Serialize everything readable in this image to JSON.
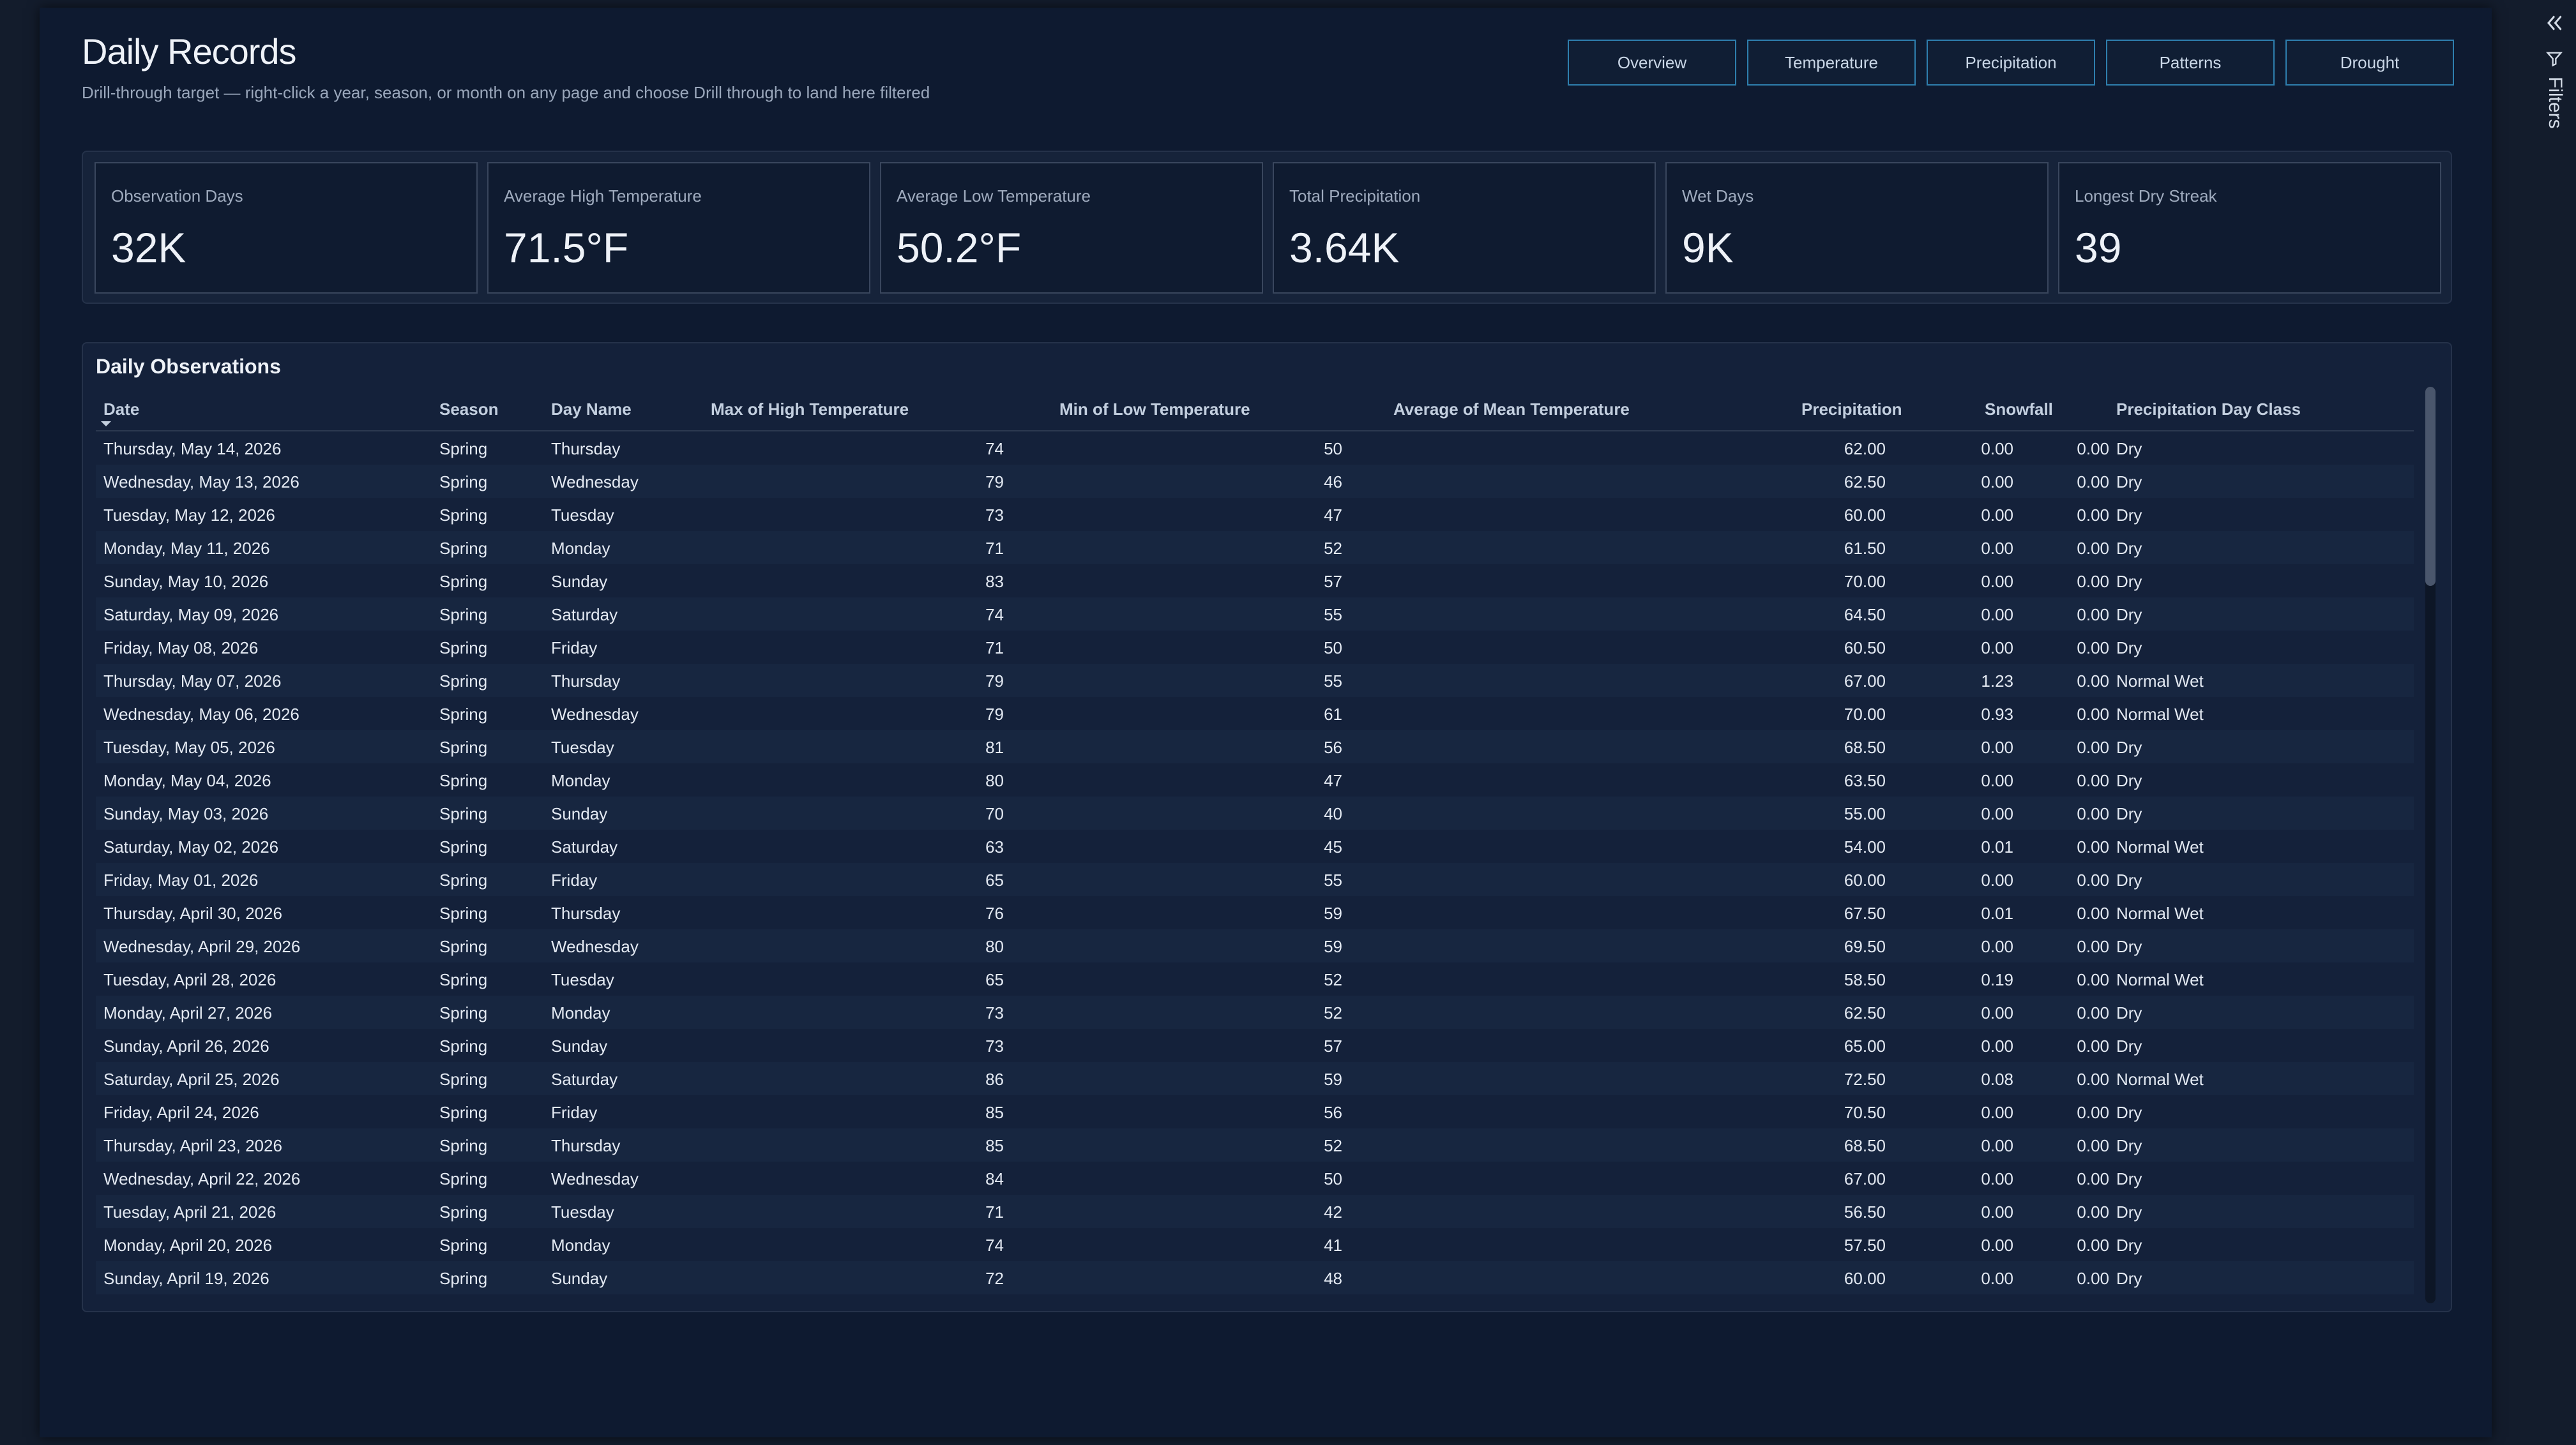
{
  "header": {
    "title": "Daily Records",
    "subtitle": "Drill-through target — right-click a year, season, or month on any page and choose Drill through to land here filtered"
  },
  "nav": [
    {
      "label": "Overview"
    },
    {
      "label": "Temperature"
    },
    {
      "label": "Precipitation"
    },
    {
      "label": "Patterns"
    },
    {
      "label": "Drought"
    }
  ],
  "kpis": [
    {
      "label": "Observation Days",
      "value": "32K"
    },
    {
      "label": "Average High Temperature",
      "value": "71.5°F"
    },
    {
      "label": "Average Low Temperature",
      "value": "50.2°F"
    },
    {
      "label": "Total Precipitation",
      "value": "3.64K"
    },
    {
      "label": "Wet Days",
      "value": "9K"
    },
    {
      "label": "Longest Dry Streak",
      "value": "39"
    }
  ],
  "table": {
    "title": "Daily Observations",
    "columns": [
      "Date",
      "Season",
      "Day Name",
      "Max of High Temperature",
      "Min of Low Temperature",
      "Average of Mean Temperature",
      "Precipitation",
      "Snowfall",
      "Precipitation Day Class"
    ],
    "rows": [
      [
        "Thursday, May 14, 2026",
        "Spring",
        "Thursday",
        "74",
        "50",
        "62.00",
        "0.00",
        "0.00",
        "Dry"
      ],
      [
        "Wednesday, May 13, 2026",
        "Spring",
        "Wednesday",
        "79",
        "46",
        "62.50",
        "0.00",
        "0.00",
        "Dry"
      ],
      [
        "Tuesday, May 12, 2026",
        "Spring",
        "Tuesday",
        "73",
        "47",
        "60.00",
        "0.00",
        "0.00",
        "Dry"
      ],
      [
        "Monday, May 11, 2026",
        "Spring",
        "Monday",
        "71",
        "52",
        "61.50",
        "0.00",
        "0.00",
        "Dry"
      ],
      [
        "Sunday, May 10, 2026",
        "Spring",
        "Sunday",
        "83",
        "57",
        "70.00",
        "0.00",
        "0.00",
        "Dry"
      ],
      [
        "Saturday, May 09, 2026",
        "Spring",
        "Saturday",
        "74",
        "55",
        "64.50",
        "0.00",
        "0.00",
        "Dry"
      ],
      [
        "Friday, May 08, 2026",
        "Spring",
        "Friday",
        "71",
        "50",
        "60.50",
        "0.00",
        "0.00",
        "Dry"
      ],
      [
        "Thursday, May 07, 2026",
        "Spring",
        "Thursday",
        "79",
        "55",
        "67.00",
        "1.23",
        "0.00",
        "Normal Wet"
      ],
      [
        "Wednesday, May 06, 2026",
        "Spring",
        "Wednesday",
        "79",
        "61",
        "70.00",
        "0.93",
        "0.00",
        "Normal Wet"
      ],
      [
        "Tuesday, May 05, 2026",
        "Spring",
        "Tuesday",
        "81",
        "56",
        "68.50",
        "0.00",
        "0.00",
        "Dry"
      ],
      [
        "Monday, May 04, 2026",
        "Spring",
        "Monday",
        "80",
        "47",
        "63.50",
        "0.00",
        "0.00",
        "Dry"
      ],
      [
        "Sunday, May 03, 2026",
        "Spring",
        "Sunday",
        "70",
        "40",
        "55.00",
        "0.00",
        "0.00",
        "Dry"
      ],
      [
        "Saturday, May 02, 2026",
        "Spring",
        "Saturday",
        "63",
        "45",
        "54.00",
        "0.01",
        "0.00",
        "Normal Wet"
      ],
      [
        "Friday, May 01, 2026",
        "Spring",
        "Friday",
        "65",
        "55",
        "60.00",
        "0.00",
        "0.00",
        "Dry"
      ],
      [
        "Thursday, April 30, 2026",
        "Spring",
        "Thursday",
        "76",
        "59",
        "67.50",
        "0.01",
        "0.00",
        "Normal Wet"
      ],
      [
        "Wednesday, April 29, 2026",
        "Spring",
        "Wednesday",
        "80",
        "59",
        "69.50",
        "0.00",
        "0.00",
        "Dry"
      ],
      [
        "Tuesday, April 28, 2026",
        "Spring",
        "Tuesday",
        "65",
        "52",
        "58.50",
        "0.19",
        "0.00",
        "Normal Wet"
      ],
      [
        "Monday, April 27, 2026",
        "Spring",
        "Monday",
        "73",
        "52",
        "62.50",
        "0.00",
        "0.00",
        "Dry"
      ],
      [
        "Sunday, April 26, 2026",
        "Spring",
        "Sunday",
        "73",
        "57",
        "65.00",
        "0.00",
        "0.00",
        "Dry"
      ],
      [
        "Saturday, April 25, 2026",
        "Spring",
        "Saturday",
        "86",
        "59",
        "72.50",
        "0.08",
        "0.00",
        "Normal Wet"
      ],
      [
        "Friday, April 24, 2026",
        "Spring",
        "Friday",
        "85",
        "56",
        "70.50",
        "0.00",
        "0.00",
        "Dry"
      ],
      [
        "Thursday, April 23, 2026",
        "Spring",
        "Thursday",
        "85",
        "52",
        "68.50",
        "0.00",
        "0.00",
        "Dry"
      ],
      [
        "Wednesday, April 22, 2026",
        "Spring",
        "Wednesday",
        "84",
        "50",
        "67.00",
        "0.00",
        "0.00",
        "Dry"
      ],
      [
        "Tuesday, April 21, 2026",
        "Spring",
        "Tuesday",
        "71",
        "42",
        "56.50",
        "0.00",
        "0.00",
        "Dry"
      ],
      [
        "Monday, April 20, 2026",
        "Spring",
        "Monday",
        "74",
        "41",
        "57.50",
        "0.00",
        "0.00",
        "Dry"
      ],
      [
        "Sunday, April 19, 2026",
        "Spring",
        "Sunday",
        "72",
        "48",
        "60.00",
        "0.00",
        "0.00",
        "Dry"
      ]
    ]
  },
  "filters_pane": {
    "label": "Filters",
    "collapse_icon": "double-chevron-left-icon",
    "filter_icon": "funnel-icon"
  },
  "colors": {
    "accent_border": "#2e7fae",
    "background": "#0e1a30"
  }
}
